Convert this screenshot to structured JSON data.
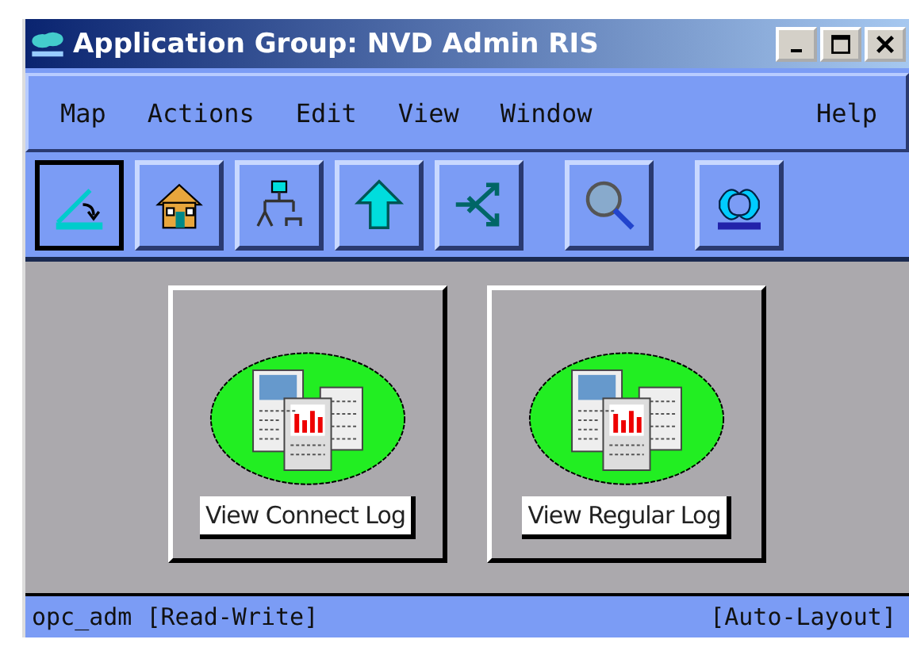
{
  "window": {
    "title": "Application Group: NVD Admin RIS"
  },
  "menu": [
    "Map",
    "Actions",
    "Edit",
    "View",
    "Window",
    "Help"
  ],
  "toolbar": [
    {
      "kind": "layout",
      "selected": true
    },
    {
      "kind": "home",
      "selected": false
    },
    {
      "kind": "tree",
      "selected": false
    },
    {
      "kind": "up",
      "selected": false
    },
    {
      "kind": "branch",
      "selected": false
    },
    {
      "kind": "search",
      "selected": false
    },
    {
      "kind": "logo",
      "selected": false
    }
  ],
  "symbols": [
    {
      "label": "View Connect Log"
    },
    {
      "label": "View Regular Log"
    }
  ],
  "status_bar": {
    "left": "opc_adm [Read-Write]",
    "right": "[Auto-Layout]"
  }
}
